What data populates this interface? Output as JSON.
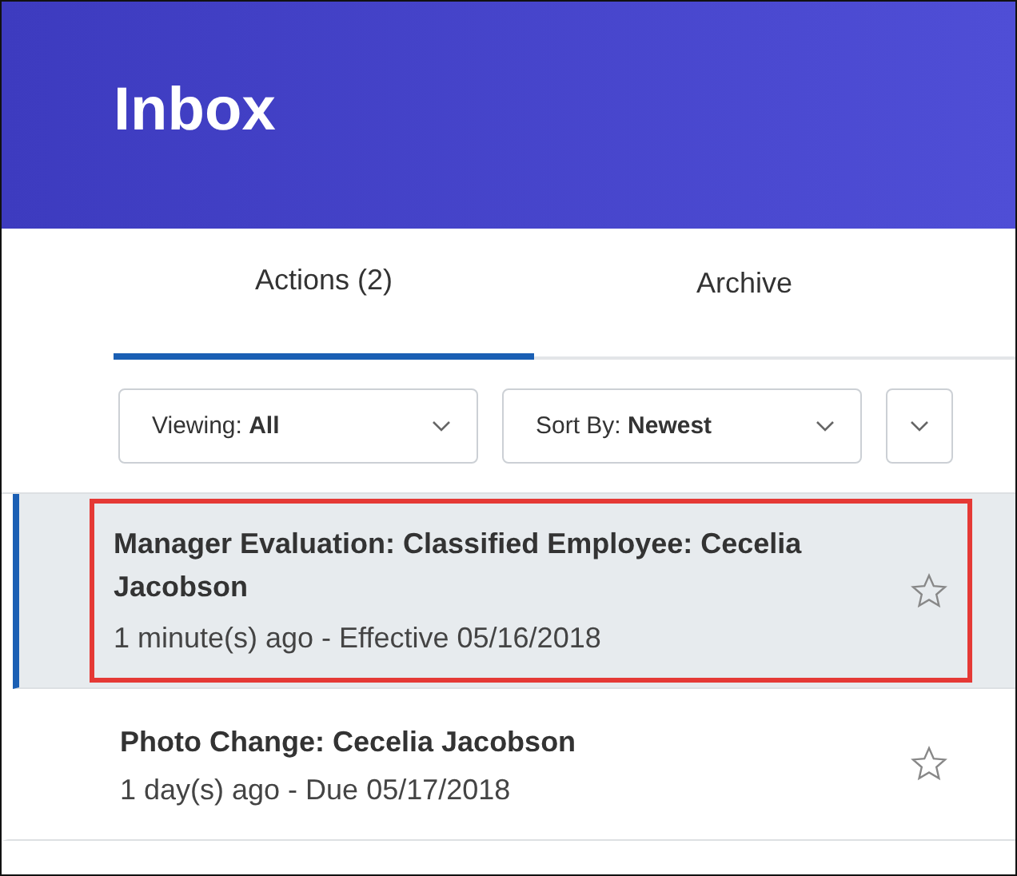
{
  "header": {
    "title": "Inbox"
  },
  "tabs": [
    {
      "label": "Actions (2)",
      "selected": true
    },
    {
      "label": "Archive",
      "selected": false
    }
  ],
  "filters": [
    {
      "label": "Viewing:",
      "value": "All"
    },
    {
      "label": "Sort By:",
      "value": "Newest"
    }
  ],
  "items": [
    {
      "title": "Manager Evaluation: Classified Employee: Cecelia Jacobson",
      "subtitle": "1 minute(s) ago - Effective 05/16/2018",
      "selected": true,
      "highlighted": true,
      "starred": false
    },
    {
      "title": "Photo Change: Cecelia Jacobson",
      "subtitle": "1 day(s) ago - Due 05/17/2018",
      "selected": false,
      "highlighted": false,
      "starred": false
    }
  ]
}
